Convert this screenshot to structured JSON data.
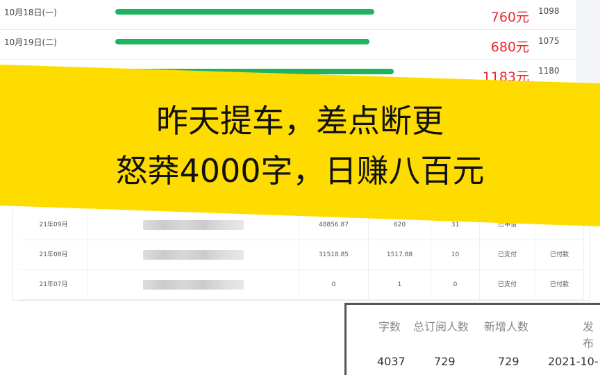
{
  "daily": [
    {
      "date": "10月18日(一)",
      "amount": "760元",
      "count": "1098",
      "progress": 0.75
    },
    {
      "date": "10月19日(二)",
      "amount": "680元",
      "count": "1075",
      "progress": 0.73
    },
    {
      "date": "",
      "amount": "1183元",
      "count": "1180",
      "progress": 0.81
    }
  ],
  "banner": {
    "line1": "昨天提车，差点断更",
    "line2": "怒莽4000字，日赚八百元"
  },
  "monthly": [
    {
      "month": "21年09月",
      "total": "48856.87",
      "earn": "620",
      "n": "31",
      "status": "已申请",
      "pay": ""
    },
    {
      "month": "21年08月",
      "total": "31518.85",
      "earn": "1517.88",
      "n": "10",
      "status": "已支付",
      "pay": "已付款"
    },
    {
      "month": "21年07月",
      "total": "0",
      "earn": "1",
      "n": "0",
      "status": "已支付",
      "pay": "已付款"
    }
  ],
  "chapter": {
    "headers": [
      "字数",
      "总订阅人数",
      "新增人数",
      "发布"
    ],
    "values": [
      "4037",
      "729",
      "729",
      "2021-10-"
    ]
  },
  "colors": {
    "bar": "#1fb35d",
    "amount": "#e8272d",
    "banner": "#ffdc00"
  }
}
